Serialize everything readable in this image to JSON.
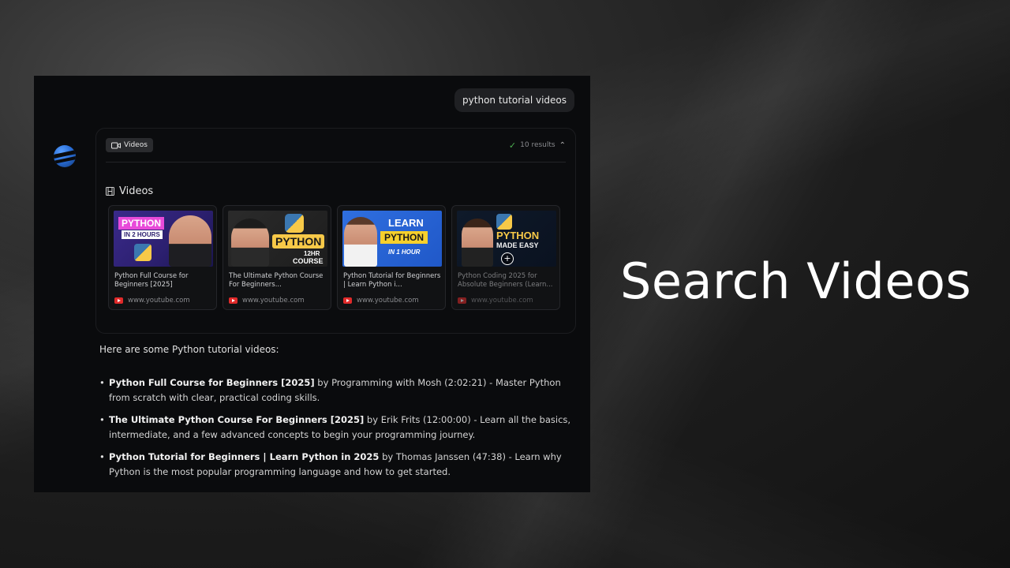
{
  "query": "python tutorial videos",
  "tool": {
    "chip_label": "Videos",
    "results_text": "10 results",
    "section_title": "Videos"
  },
  "videos": [
    {
      "title": "Python Full Course for Beginners [2025]",
      "source": "www.youtube.com",
      "thumb_text": [
        "PYTHON",
        "IN 2 HOURS"
      ]
    },
    {
      "title": "The Ultimate Python Course For Beginners...",
      "source": "www.youtube.com",
      "thumb_text": [
        "PYTHON",
        "12HR",
        "COURSE"
      ]
    },
    {
      "title": "Python Tutorial for Beginners | Learn Python i...",
      "source": "www.youtube.com",
      "thumb_text": [
        "LEARN",
        "PYTHON",
        "IN 1 HOUR"
      ]
    },
    {
      "title": "Python Coding 2025 for Absolute Beginners (Learn...",
      "source": "www.youtube.com",
      "thumb_text": [
        "PYTHON",
        "MADE EASY"
      ]
    }
  ],
  "answer": {
    "intro": "Here are some Python tutorial videos:",
    "items": [
      {
        "title": "Python Full Course for Beginners [2025]",
        "rest": " by Programming with Mosh (2:02:21) - Master Python from scratch with clear, practical coding skills."
      },
      {
        "title": "The Ultimate Python Course For Beginners [2025]",
        "rest": " by Erik Frits (12:00:00) - Learn all the basics, intermediate, and a few advanced concepts to begin your programming journey."
      },
      {
        "title": "Python Tutorial for Beginners | Learn Python in 2025",
        "rest": " by Thomas Janssen (47:38) - Learn why Python is the most popular programming language and how to get started."
      }
    ]
  },
  "headline": "Search Videos",
  "colors": {
    "panel_bg": "#0a0b0d",
    "accent_check": "#4caf50",
    "youtube_red": "#e02a2a"
  },
  "icons": [
    "camera-icon",
    "check-icon",
    "chevron-up-icon",
    "film-icon",
    "youtube-icon",
    "assistant-avatar"
  ]
}
